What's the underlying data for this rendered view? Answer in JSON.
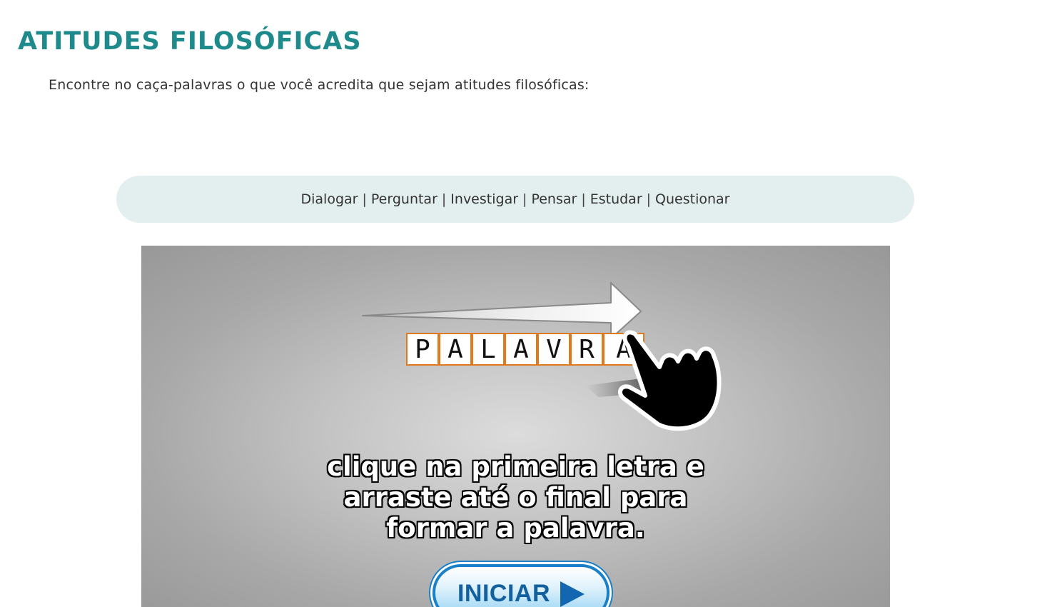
{
  "page": {
    "title": "ATITUDES FILOSÓFICAS",
    "instruction": "Encontre no caça-palavras o que você acredita que sejam atitudes filosóficas:"
  },
  "word_bank": {
    "words": [
      "Dialogar",
      "Perguntar",
      "Investigar",
      "Pensar",
      "Estudar",
      "Questionar"
    ],
    "separator": "|"
  },
  "game": {
    "example_letters": [
      "P",
      "A",
      "L",
      "A",
      "V",
      "R",
      "A"
    ],
    "tutorial_lines": [
      "clique na primeira letra e",
      "arraste até o final para",
      "formar a palavra."
    ],
    "start_button_label": "INICIAR",
    "icons": [
      "arrow-right-icon",
      "pointing-hand-icon",
      "play-icon"
    ],
    "colors": {
      "title": "#1f8a8c",
      "word_bank_bg": "#e3efee",
      "letter_border": "#e07a20",
      "button_border": "#1a80c8",
      "button_text": "#13609e"
    }
  }
}
